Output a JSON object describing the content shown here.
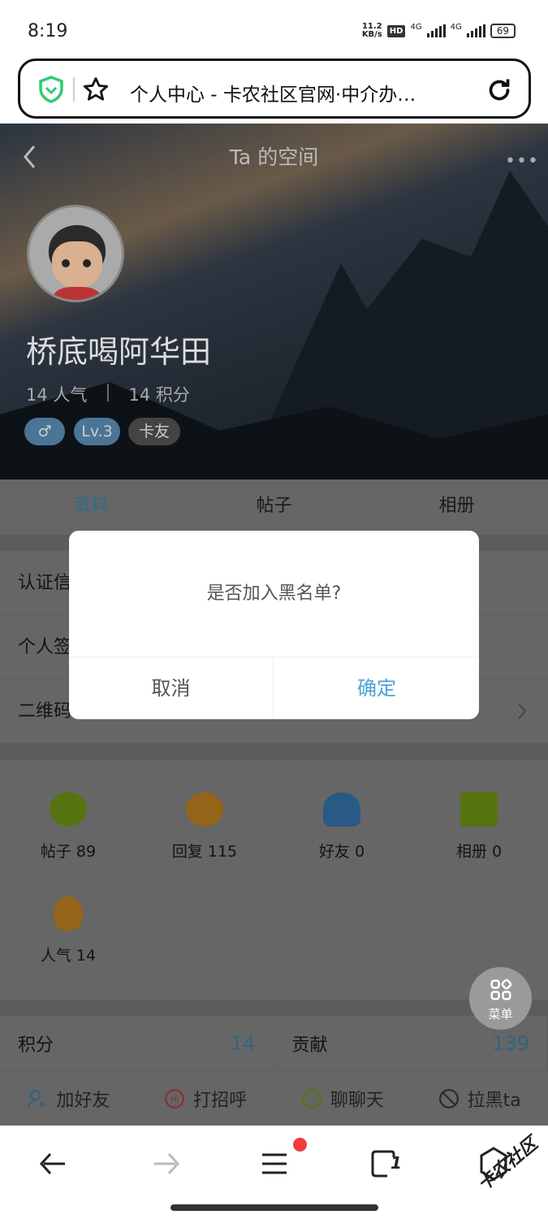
{
  "status": {
    "time": "8:19",
    "speed_value": "11.2",
    "speed_unit": "KB/s",
    "hd": "HD",
    "net1": "4G",
    "net2": "4G",
    "battery": "69"
  },
  "browser": {
    "url_title": "个人中心 - 卡农社区官网·中介办…",
    "icons": [
      "shield-check-icon",
      "star-icon",
      "reload-icon"
    ],
    "shield_color": "#2ecc71"
  },
  "header": {
    "title": "Ta 的空间",
    "username": "桥底喝阿华田",
    "popularity": "14 人气",
    "points": "14 积分",
    "separator": "|",
    "tags": [
      "♂",
      "Lv.3",
      "卡友"
    ]
  },
  "tabs": [
    {
      "label": "资料",
      "active": true
    },
    {
      "label": "帖子"
    },
    {
      "label": "相册"
    }
  ],
  "info_rows": [
    {
      "label": "认证信"
    },
    {
      "label": "个人签"
    },
    {
      "label": "二维码"
    }
  ],
  "grid": [
    {
      "label": "帖子 89",
      "icon": "chat-bubble-icon",
      "color": "#8fc31f"
    },
    {
      "label": "回复 115",
      "icon": "reply-bubbles-icon",
      "color": "#f5a623"
    },
    {
      "label": "好友 0",
      "icon": "friends-icon",
      "color": "#3b8fd9"
    },
    {
      "label": "相册 0",
      "icon": "album-icon",
      "color": "#8fc31f"
    },
    {
      "label": "人气 14",
      "icon": "footprint-icon",
      "color": "#f5a623"
    }
  ],
  "stats": [
    {
      "label": "积分",
      "value": "14"
    },
    {
      "label": "贡献",
      "value": "139"
    }
  ],
  "actions": [
    {
      "label": "加好友",
      "icon": "add-user-icon",
      "color": "#4ba3d6"
    },
    {
      "label": "打招呼",
      "icon": "hi-icon",
      "color": "#e0474c"
    },
    {
      "label": "聊聊天",
      "icon": "chat-icon",
      "color": "#8fc31f"
    },
    {
      "label": "拉黑ta",
      "icon": "block-icon",
      "color": "#555"
    }
  ],
  "menu_button": {
    "label": "菜单"
  },
  "dialog": {
    "message": "是否加入黑名单?",
    "cancel": "取消",
    "confirm": "确定",
    "confirm_color": "#4ba3d6"
  },
  "bottom_nav": {
    "icons": [
      "back-icon",
      "forward-icon",
      "menu-icon",
      "tabs-icon",
      "home-icon"
    ],
    "tab_count": "1"
  },
  "watermark": "卡农社区",
  "accent": "#4ba3d6"
}
